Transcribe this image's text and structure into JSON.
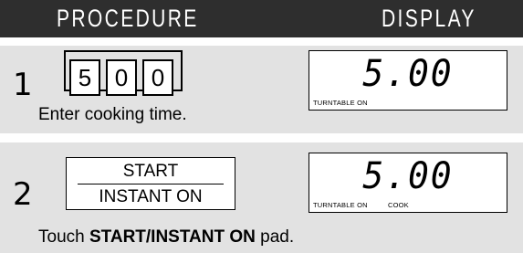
{
  "header": {
    "procedure": "PROCEDURE",
    "display": "DISPLAY"
  },
  "steps": [
    {
      "number": "1",
      "keys": [
        "5",
        "0",
        "0"
      ],
      "caption": "Enter cooking time.",
      "display": {
        "digits": "5.00",
        "indicators": [
          "TURNTABLE ON"
        ]
      }
    },
    {
      "number": "2",
      "pad": {
        "line1": "START",
        "line2": "INSTANT ON"
      },
      "caption_prefix": "Touch ",
      "caption_bold": "START/INSTANT ON",
      "caption_suffix": " pad.",
      "display": {
        "digits": "5.00",
        "indicators": [
          "TURNTABLE ON",
          "COOK"
        ]
      }
    }
  ]
}
